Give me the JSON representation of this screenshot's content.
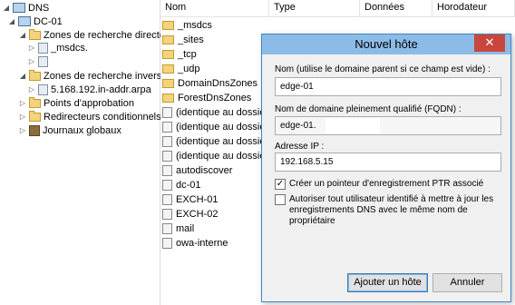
{
  "tree": {
    "items": [
      {
        "label": "DNS",
        "icon": "dns-icon",
        "twisty": "◢"
      },
      {
        "label": "DC-01",
        "icon": "server-icon",
        "twisty": "◢"
      },
      {
        "label": "Zones de recherche directes",
        "icon": "folder-icon",
        "twisty": "◢"
      },
      {
        "label": "_msdcs.",
        "icon": "zone-icon",
        "twisty": "▷"
      },
      {
        "label": "",
        "icon": "zone-icon",
        "twisty": "▷"
      },
      {
        "label": "Zones de recherche inversée",
        "icon": "folder-icon",
        "twisty": "◢"
      },
      {
        "label": "5.168.192.in-addr.arpa",
        "icon": "zone-icon",
        "twisty": "▷"
      },
      {
        "label": "Points d'approbation",
        "icon": "folder-icon",
        "twisty": "▷"
      },
      {
        "label": "Redirecteurs conditionnels",
        "icon": "folder-icon",
        "twisty": "▷"
      },
      {
        "label": "Journaux globaux",
        "icon": "log-book-icon",
        "twisty": "▷"
      }
    ]
  },
  "list": {
    "columns": [
      "Nom",
      "Type",
      "Données",
      "Horodateur"
    ],
    "rows": [
      {
        "name": "_msdcs",
        "icon": "folder"
      },
      {
        "name": "_sites",
        "icon": "folder"
      },
      {
        "name": "_tcp",
        "icon": "folder"
      },
      {
        "name": "_udp",
        "icon": "folder"
      },
      {
        "name": "DomainDnsZones",
        "icon": "folder"
      },
      {
        "name": "ForestDnsZones",
        "icon": "folder"
      },
      {
        "name": "(identique au dossier",
        "icon": "record"
      },
      {
        "name": "(identique au dossier",
        "icon": "record"
      },
      {
        "name": "(identique au dossier",
        "icon": "record"
      },
      {
        "name": "(identique au dossier",
        "icon": "record"
      },
      {
        "name": "autodiscover",
        "icon": "record"
      },
      {
        "name": "dc-01",
        "icon": "record"
      },
      {
        "name": "EXCH-01",
        "icon": "record"
      },
      {
        "name": "EXCH-02",
        "icon": "record"
      },
      {
        "name": "mail",
        "icon": "record"
      },
      {
        "name": "owa-interne",
        "icon": "record"
      }
    ]
  },
  "dialog": {
    "title": "Nouvel hôte",
    "close_label": "✕",
    "name_label": "Nom (utilise le domaine parent si ce champ est vide) :",
    "name_value": "edge-01",
    "fqdn_label": "Nom de domaine pleinement qualifié (FQDN) :",
    "fqdn_value": "edge-01.",
    "ip_label": "Adresse IP :",
    "ip_value": "192.168.5.15",
    "ptr_label": "Créer un pointeur d'enregistrement PTR associé",
    "ptr_checked": true,
    "auth_label": "Autoriser tout utilisateur identifié à mettre à jour les enregistrements DNS avec le même nom de propriétaire",
    "auth_checked": false,
    "add_button": "Ajouter un hôte",
    "cancel_button": "Annuler"
  },
  "colors": {
    "titlebar": "#8dbbe7",
    "close": "#c9463d",
    "dialog_bg": "#f0f0f0"
  }
}
